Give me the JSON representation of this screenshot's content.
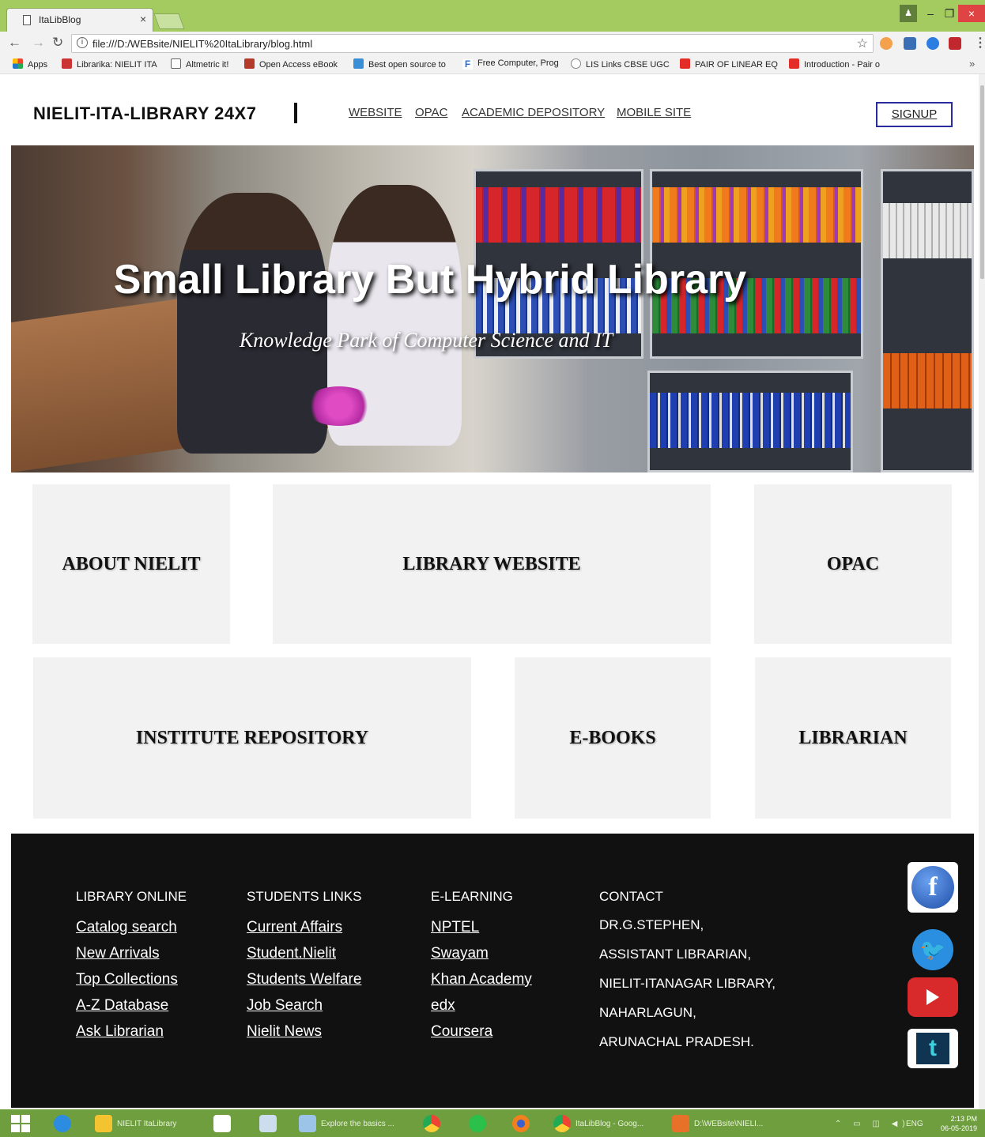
{
  "browser": {
    "tab_title": "ItaLibBlog",
    "url": "file:///D:/WEBsite/NIELIT%20ItaLibrary/blog.html",
    "bookmarks": [
      "Apps",
      "Librarika: NIELIT ITA",
      "Altmetric it!",
      "Open Access eBook",
      "Best open source to",
      "Free Computer, Prog",
      "LIS Links CBSE UGC",
      "PAIR OF LINEAR EQ",
      "Introduction - Pair o"
    ]
  },
  "header": {
    "brand": "NIELIT-ITA-LIBRARY 24X7",
    "nav": [
      "WEBSITE",
      "OPAC",
      "ACADEMIC DEPOSITORY",
      "MOBILE SITE"
    ],
    "signup": "SIGNUP"
  },
  "hero": {
    "title": "Small Library But Hybrid Library",
    "subtitle": "Knowledge Park of Computer Science and IT"
  },
  "tiles": [
    "ABOUT NIELIT",
    "LIBRARY WEBSITE",
    "OPAC",
    "INSTITUTE REPOSITORY",
    "E-BOOKS",
    "LIBRARIAN"
  ],
  "footer": {
    "library_online": {
      "heading": "LIBRARY ONLINE",
      "links": [
        "Catalog search",
        "New Arrivals",
        "Top Collections",
        "A-Z Database",
        "Ask Librarian"
      ]
    },
    "students_links": {
      "heading": "STUDENTS LINKS",
      "links": [
        "Current Affairs",
        "Student.Nielit",
        "Students Welfare",
        "Job Search",
        "Nielit News"
      ]
    },
    "e_learning": {
      "heading": "E-LEARNING",
      "links": [
        "NPTEL",
        "Swayam",
        "Khan Academy",
        "edx",
        "Coursera"
      ]
    },
    "contact": {
      "heading": "CONTACT",
      "lines": [
        "DR.G.STEPHEN,",
        "ASSISTANT LIBRARIAN,",
        "NIELIT-ITANAGAR LIBRARY,",
        "NAHARLAGUN,",
        "ARUNACHAL PRADESH."
      ]
    },
    "social_icons": [
      "facebook-icon",
      "twitter-icon",
      "youtube-icon",
      "tumblr-icon"
    ]
  },
  "taskbar": {
    "items": [
      "NIELIT ItaLibrary",
      "Explore the basics ...",
      "ItaLibBlog - Goog...",
      "D:\\WEBsite\\NIELI..."
    ],
    "language": "ENG",
    "time": "2:13 PM",
    "date": "06-05-2019"
  },
  "colors": {
    "tabbar": "#a4cb60",
    "taskbar": "#6f9e3e",
    "tile_bg": "#f2f2f2",
    "footer_bg": "#111111",
    "signup_border": "#2b2ba0"
  }
}
